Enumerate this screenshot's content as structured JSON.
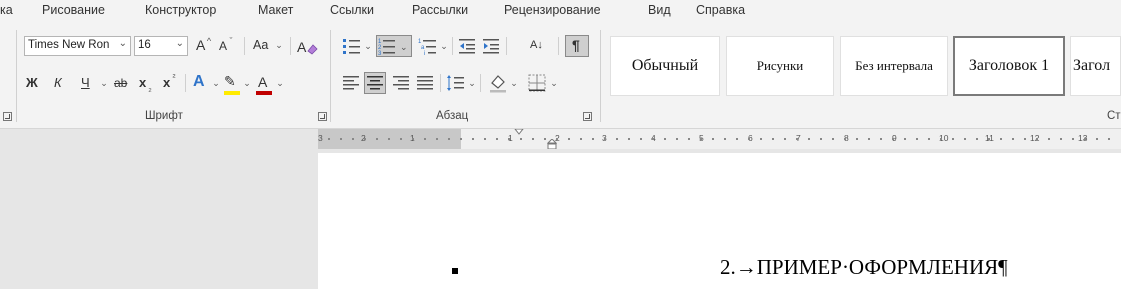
{
  "tabs": [
    "ка",
    "Рисование",
    "Конструктор",
    "Макет",
    "Ссылки",
    "Рассылки",
    "Рецензирование",
    "Вид",
    "Справка"
  ],
  "font": {
    "name_value": "Times New Ron",
    "size_value": "16",
    "grow_label": "A",
    "shrink_label": "A",
    "case_label": "Aa",
    "bold_label": "Ж",
    "italic_label": "К",
    "underline_label": "Ч",
    "strike_label": "ab",
    "subscript_label": "x",
    "superscript_label": "x",
    "effects_label": "A",
    "highlight_label": "✎",
    "color_label": "A",
    "group_label": "Шрифт",
    "highlight_color": "#ffeb00",
    "font_color": "#c00000"
  },
  "paragraph": {
    "group_label": "Абзац",
    "sort_label": "А↓",
    "pilcrow_label": "¶"
  },
  "styles": {
    "items": [
      "Обычный",
      "Рисунки",
      "Без интервала",
      "Заголовок 1",
      "Загол"
    ],
    "selected_index": 3,
    "group_label": "Ст"
  },
  "ruler": {
    "numbers": [
      "3",
      "2",
      "1",
      "1",
      "2",
      "3",
      "4",
      "5",
      "6",
      "7",
      "8",
      "9",
      "10",
      "11",
      "12",
      "13"
    ]
  },
  "document": {
    "heading_text": "2.→ПРИМЕР·ОФОРМЛЕНИЯ¶"
  }
}
